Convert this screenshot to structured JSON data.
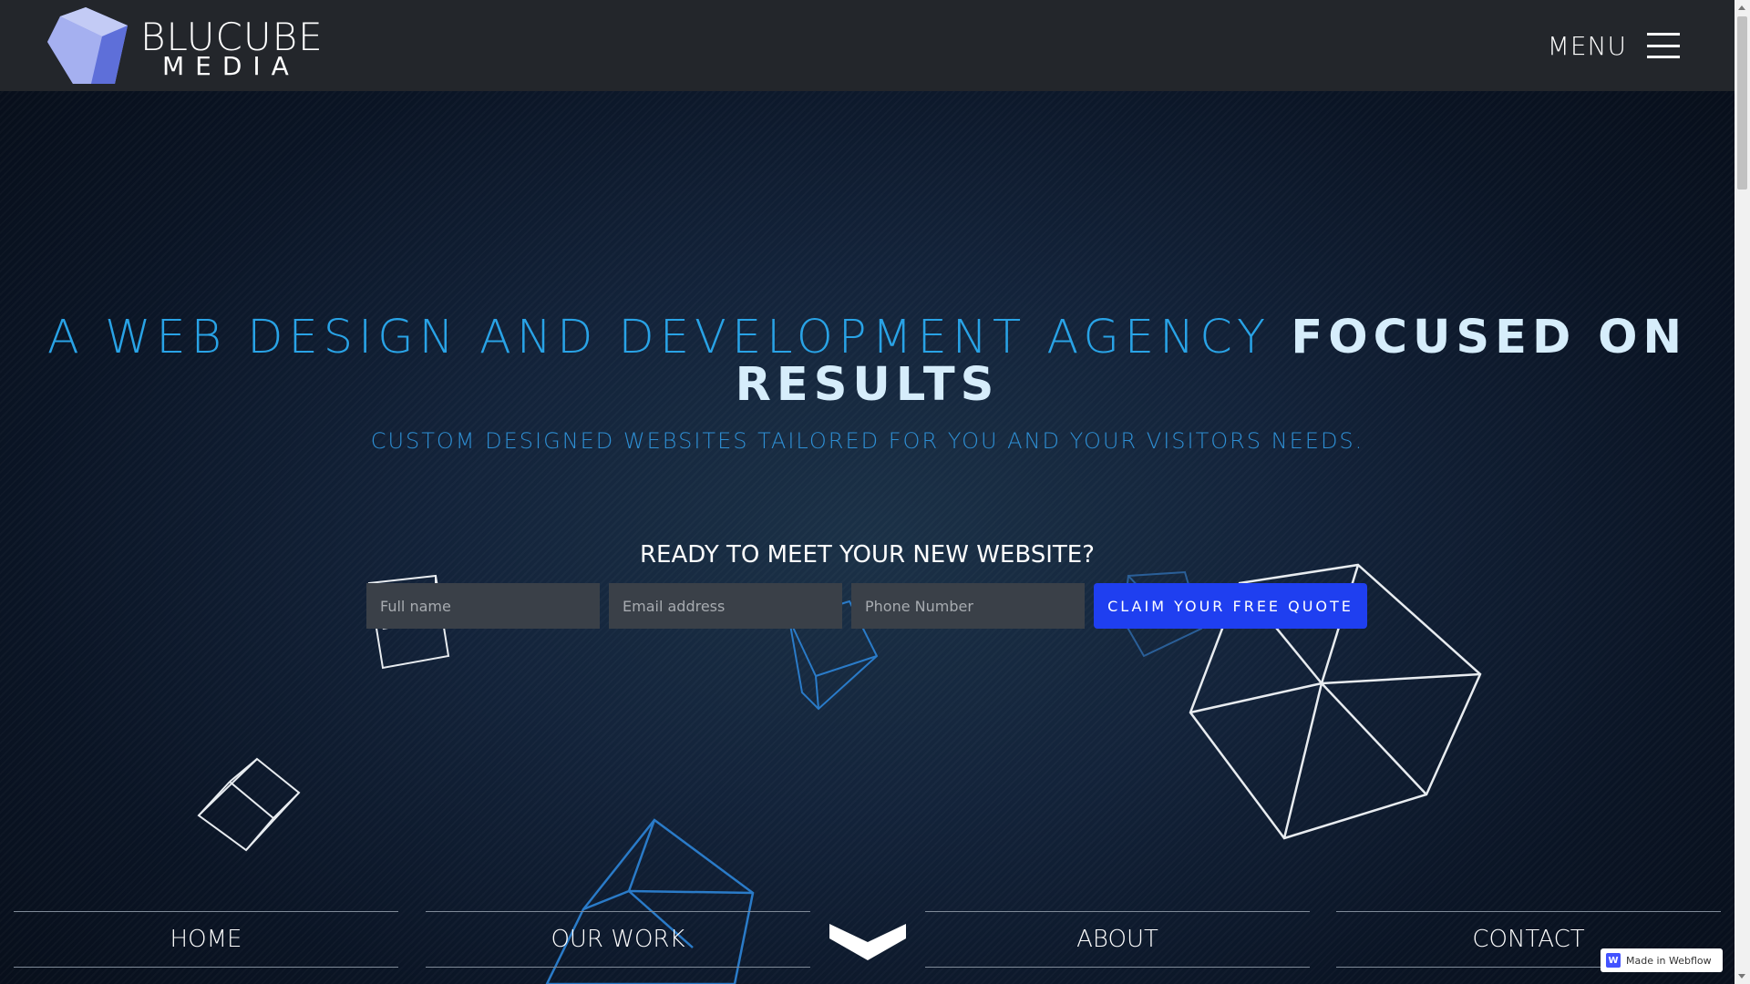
{
  "header": {
    "logo_line1": "BLUCUBE",
    "logo_line2": "MEDIA",
    "menu_label": "MENU"
  },
  "hero": {
    "title_light": "A WEB DESIGN AND DEVELOPMENT AGENCY ",
    "title_strong": "FOCUSED ON RESULTS",
    "subtitle": "CUSTOM DESIGNED WEBSITES TAILORED FOR YOU AND YOUR VISITORS NEEDS."
  },
  "quote_form": {
    "heading": "READY TO MEET YOUR NEW WEBSITE?",
    "name_placeholder": "Full name",
    "email_placeholder": "Email address",
    "phone_placeholder": "Phone Number",
    "submit_label": "CLAIM YOUR FREE QUOTE"
  },
  "bottom_nav": {
    "items": [
      {
        "label": "HOME"
      },
      {
        "label": "OUR WORK"
      },
      {
        "label": "ABOUT"
      },
      {
        "label": "CONTACT"
      }
    ]
  },
  "badge": {
    "label": "Made in Webflow",
    "logo_letter": "W"
  },
  "icons": [
    "cube-logo-icon",
    "hamburger-menu-icon",
    "chevron-down-icon",
    "webflow-logo-icon"
  ],
  "colors": {
    "accent_blue": "#29a3e6",
    "button_blue": "#1f3ff0",
    "header_bg": "#23262b"
  }
}
